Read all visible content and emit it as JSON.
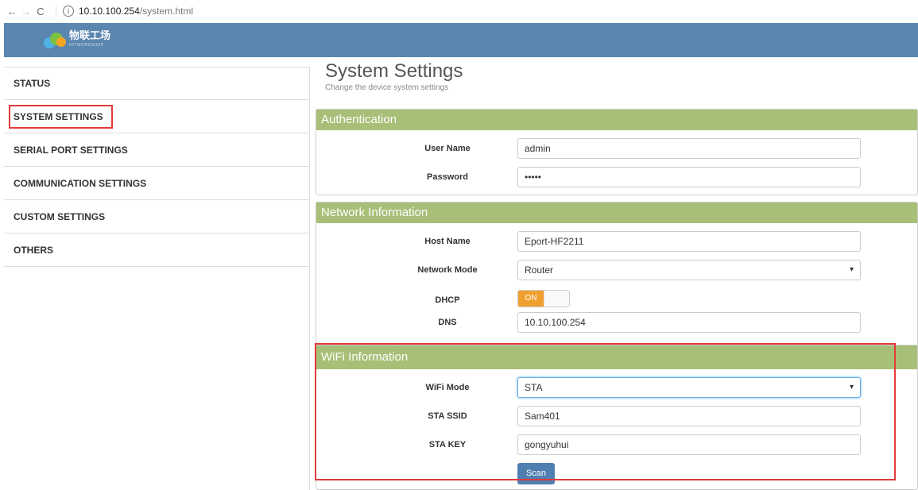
{
  "browser": {
    "back_icon": "←",
    "forward_icon": "→",
    "reload_icon": "C",
    "url_host": "10.10.100.254",
    "url_path": "/system.html"
  },
  "header": {
    "logo_text": "物联工场",
    "logo_sub": "IOTWORKSHOP"
  },
  "sidebar": {
    "items": [
      {
        "label": "STATUS"
      },
      {
        "label": "SYSTEM SETTINGS",
        "active": true
      },
      {
        "label": "SERIAL PORT SETTINGS"
      },
      {
        "label": "COMMUNICATION SETTINGS"
      },
      {
        "label": "CUSTOM SETTINGS"
      },
      {
        "label": "OTHERS"
      }
    ]
  },
  "main": {
    "title": "System Settings",
    "subtitle": "Change the device system settings",
    "auth": {
      "heading": "Authentication",
      "user_label": "User Name",
      "user_value": "admin",
      "pass_label": "Password",
      "pass_value": "•••••"
    },
    "network": {
      "heading": "Network Information",
      "host_label": "Host Name",
      "host_value": "Eport-HF2211",
      "mode_label": "Network Mode",
      "mode_value": "Router",
      "dhcp_label": "DHCP",
      "dhcp_state": "ON",
      "dns_label": "DNS",
      "dns_value": "10.10.100.254"
    },
    "wifi": {
      "heading": "WiFi Information",
      "mode_label": "WiFi Mode",
      "mode_value": "STA",
      "ssid_label": "STA SSID",
      "ssid_value": "Sam401",
      "key_label": "STA KEY",
      "key_value": "gongyuhui",
      "scan_label": "Scan"
    }
  },
  "colors": {
    "header": "#5a86b0",
    "panel_heading": "#a8bf77",
    "highlight": "#e23a3a",
    "toggle_on": "#f0a030",
    "button": "#4f7eb0"
  }
}
